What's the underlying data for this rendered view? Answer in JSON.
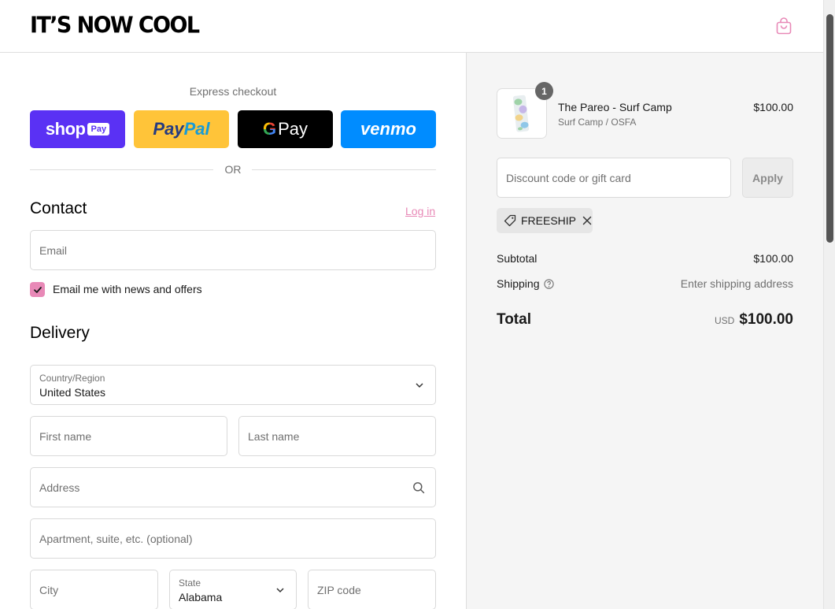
{
  "header": {
    "logo": "IT’S NOW COOL",
    "cart_icon": "shopping-bag-icon"
  },
  "express": {
    "title": "Express checkout",
    "shop_pay": {
      "word": "shop",
      "box": "Pay"
    },
    "paypal": {
      "part1": "Pay",
      "part2": "Pal"
    },
    "gpay": {
      "g": "G",
      "pay": "Pay"
    },
    "venmo": "venmo",
    "or": "OR"
  },
  "contact": {
    "title": "Contact",
    "login": "Log in",
    "email_placeholder": "Email",
    "newsletter_label": "Email me with news and offers",
    "newsletter_checked": true
  },
  "delivery": {
    "title": "Delivery",
    "country_label": "Country/Region",
    "country_value": "United States",
    "first_name": "First name",
    "last_name": "Last name",
    "address": "Address",
    "apartment": "Apartment, suite, etc. (optional)",
    "city": "City",
    "state_label": "State",
    "state_value": "Alabama",
    "zip": "ZIP code"
  },
  "summary": {
    "product": {
      "quantity": "1",
      "name": "The Pareo - Surf Camp",
      "variant": "Surf Camp / OSFA",
      "price": "$100.00"
    },
    "discount_placeholder": "Discount code or gift card",
    "apply": "Apply",
    "applied_code": "FREESHIP",
    "subtotal_label": "Subtotal",
    "subtotal_value": "$100.00",
    "shipping_label": "Shipping",
    "shipping_value": "Enter shipping address",
    "total_label": "Total",
    "total_currency": "USD",
    "total_value": "$100.00"
  },
  "colors": {
    "accent": "#e889b7",
    "shop_pay": "#5a31f4",
    "paypal": "#ffc439",
    "venmo": "#008cff"
  }
}
